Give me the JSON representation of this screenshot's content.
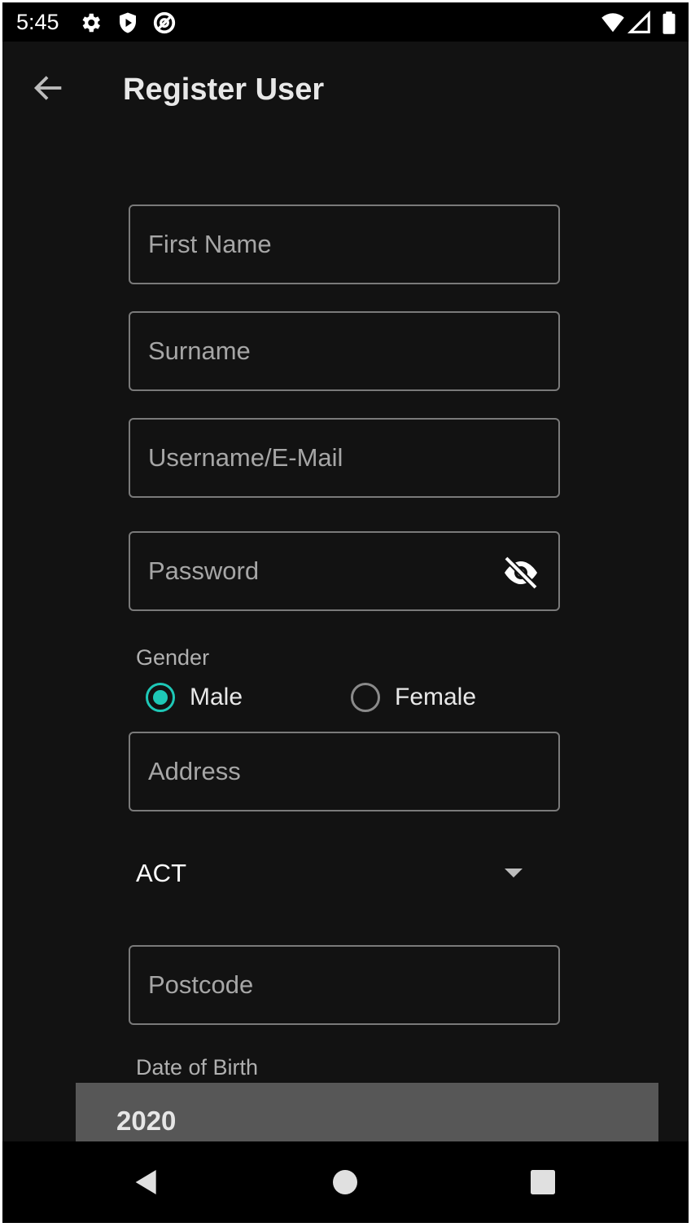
{
  "status_bar": {
    "time": "5:45",
    "left_icons": [
      "settings-icon",
      "shield-play-icon",
      "at-icon"
    ],
    "right_icons": [
      "wifi-icon",
      "cell-signal-icon",
      "battery-icon"
    ]
  },
  "app_bar": {
    "back_icon": "arrow-left-icon",
    "title": "Register User"
  },
  "form": {
    "first_name_placeholder": "First Name",
    "surname_placeholder": "Surname",
    "username_placeholder": "Username/E-Mail",
    "password_placeholder": "Password",
    "password_toggle_icon": "eye-off-icon",
    "gender_label": "Gender",
    "gender_options": [
      {
        "label": "Male",
        "selected": true
      },
      {
        "label": "Female",
        "selected": false
      }
    ],
    "address_placeholder": "Address",
    "state_selected": "ACT",
    "postcode_placeholder": "Postcode",
    "dob_label": "Date of Birth",
    "dob_year": "2020"
  },
  "nav_bar": {
    "icons": [
      "back-triangle-icon",
      "home-circle-icon",
      "recents-square-icon"
    ]
  },
  "colors": {
    "background": "#121212",
    "accent": "#1ec8b7",
    "field_border": "#7a7a7a",
    "date_header": "#575757"
  }
}
